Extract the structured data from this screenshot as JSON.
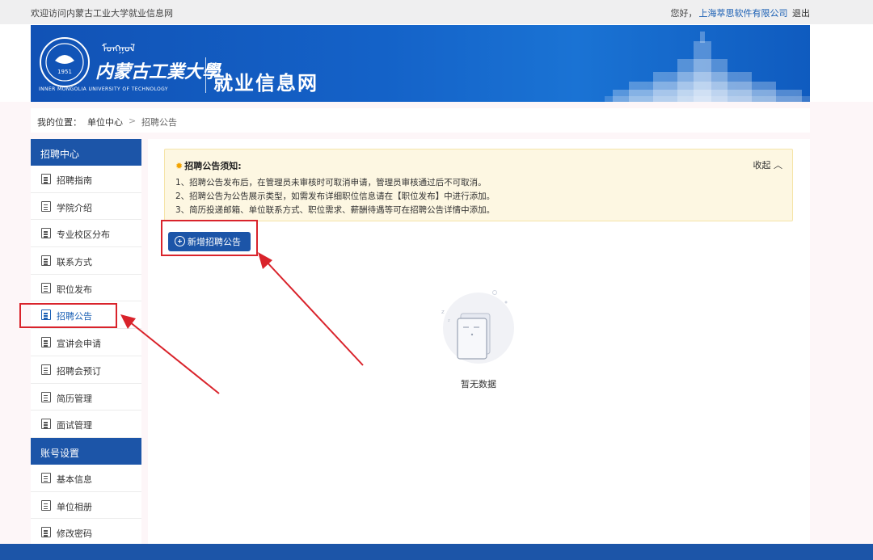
{
  "topbar": {
    "welcome": "欢迎访问内蒙古工业大学就业信息网",
    "greeting": "您好，",
    "company": "上海萃思软件有限公司",
    "logout": "退出"
  },
  "banner": {
    "university_cn": "内蒙古工業大學",
    "university_en": "INNER MONGOLIA UNIVERSITY OF TECHNOLOGY",
    "site_name": "就业信息网",
    "emblem_year": "1951"
  },
  "breadcrumb": {
    "label": "我的位置：",
    "level1": "单位中心",
    "separator": ">",
    "level2": "招聘公告"
  },
  "sidebar": {
    "section1": "招聘中心",
    "items1": [
      {
        "label": "招聘指南"
      },
      {
        "label": "学院介绍"
      },
      {
        "label": "专业校区分布"
      },
      {
        "label": "联系方式"
      },
      {
        "label": "职位发布"
      },
      {
        "label": "招聘公告",
        "active": true
      },
      {
        "label": "宣讲会申请"
      },
      {
        "label": "招聘会预订"
      },
      {
        "label": "简历管理"
      },
      {
        "label": "面试管理"
      }
    ],
    "section2": "账号设置",
    "items2": [
      {
        "label": "基本信息"
      },
      {
        "label": "单位相册"
      },
      {
        "label": "修改密码"
      }
    ]
  },
  "notice": {
    "title": "招聘公告须知:",
    "lines": [
      "1、招聘公告发布后，在管理员未审核时可取消申请，管理员审核通过后不可取消。",
      "2、招聘公告为公告展示类型，如需发布详细职位信息请在【职位发布】中进行添加。",
      "3、简历投递邮箱、单位联系方式、职位需求、薪酬待遇等可在招聘公告详情中添加。"
    ],
    "collapse": "收起 ︿"
  },
  "actions": {
    "add_label": "新增招聘公告"
  },
  "empty": {
    "text": "暂无数据"
  },
  "colors": {
    "primary": "#1c55a8",
    "highlight": "#d9232b",
    "notice_bg": "#fdf7e2"
  }
}
